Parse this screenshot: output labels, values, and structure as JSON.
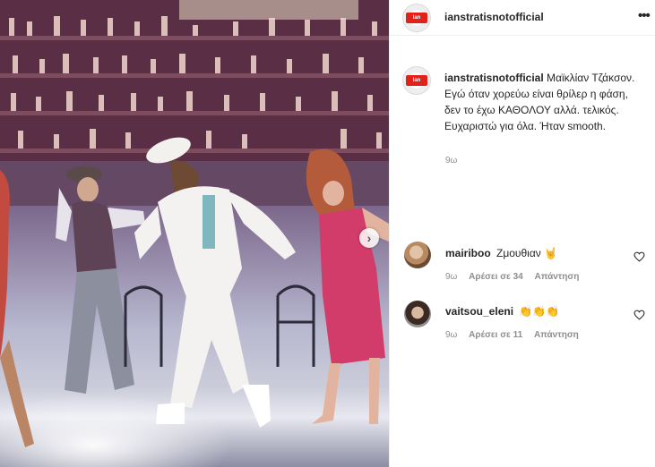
{
  "post": {
    "username": "ianstratisnotofficial",
    "avatar_logo": "Ian",
    "more_icon": "more-horizontal-icon",
    "caption": "Μαϊκλίαν Τζάκσον. Εγώ όταν χορεύω είναι θρίλερ η φάση, δεν το έχω ΚΑΘΟΛΟΥ αλλά. τελικός. Ευχαριστώ για όλα. Ήταν smooth.",
    "caption_time": "9ω"
  },
  "media": {
    "next_icon": "chevron-right-icon"
  },
  "comments": [
    {
      "username": "mairiboo",
      "text": "Ζμουθιαν 🤘",
      "time": "9ω",
      "likes": "Αρέσει σε 34",
      "reply": "Απάντηση"
    },
    {
      "username": "vaitsou_eleni",
      "text": "👏👏👏",
      "time": "9ω",
      "likes": "Αρέσει σε 11",
      "reply": "Απάντηση"
    }
  ],
  "colors": {
    "text": "#262626",
    "muted": "#8e8e8e",
    "border": "#efefef"
  }
}
